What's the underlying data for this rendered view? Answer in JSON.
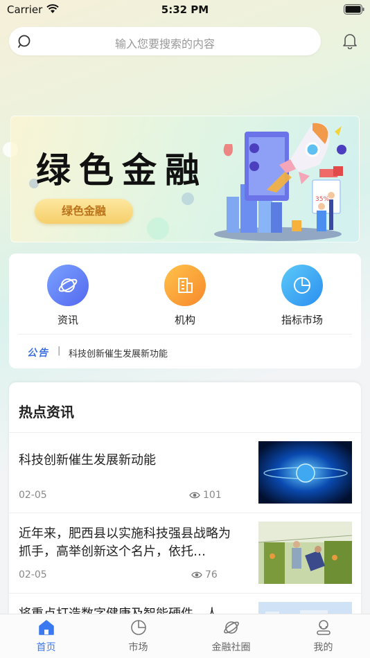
{
  "status_bar": {
    "carrier": "Carrier",
    "time": "5:32 PM"
  },
  "search": {
    "placeholder": "输入您要搜索的内容"
  },
  "banner": {
    "title": "绿色金融",
    "button_label": "绿色金融",
    "chart_label": "35%"
  },
  "nav": {
    "items": [
      {
        "label": "资讯",
        "icon": "planet-icon",
        "color": "#5b7cf5"
      },
      {
        "label": "机构",
        "icon": "building-icon",
        "color": "#f7a52c"
      },
      {
        "label": "指标市场",
        "icon": "pie-chart-icon",
        "color": "#3aa8f0"
      }
    ],
    "notice_tag": "公告",
    "notice_separator": "|",
    "notice_text": "科技创新催生发展新功能"
  },
  "news": {
    "heading": "热点资讯",
    "items": [
      {
        "title": "科技创新催生发展新动能",
        "date": "02-05",
        "views": "101"
      },
      {
        "title": "近年来，肥西县以实施科技强县战略为抓手，高举创新这个名片，依托…",
        "date": "02-05",
        "views": "76"
      },
      {
        "title": "将重点打造数字健康及智能硬件，人"
      }
    ]
  },
  "tab_bar": {
    "items": [
      {
        "label": "首页",
        "active": true
      },
      {
        "label": "市场",
        "active": false
      },
      {
        "label": "金融社圈",
        "active": false
      },
      {
        "label": "我的",
        "active": false
      }
    ],
    "active_color": "#3a79f0"
  }
}
